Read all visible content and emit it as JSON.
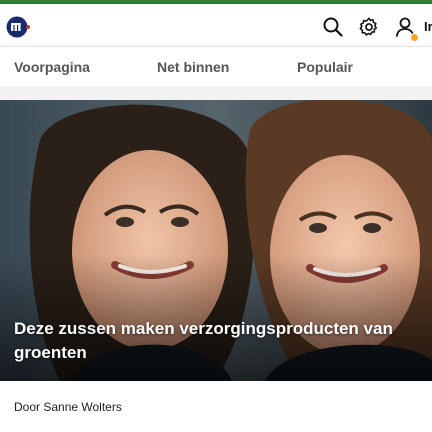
{
  "header": {
    "logo_name": "nu-logo",
    "icons": [
      "search-icon",
      "gear-icon",
      "user-icon"
    ],
    "account_label": "Ir",
    "badge_color": "#f5a623"
  },
  "nav": {
    "tabs": [
      {
        "label": "Voorpagina"
      },
      {
        "label": "Net binnen"
      },
      {
        "label": "Populair"
      }
    ]
  },
  "article": {
    "title": "Deze zussen maken verzorgingsproducten van groenten",
    "byline": "Door Sanne Wolters"
  },
  "colors": {
    "brand": "#1a2b6d",
    "top_strip": "#2e7d32"
  }
}
